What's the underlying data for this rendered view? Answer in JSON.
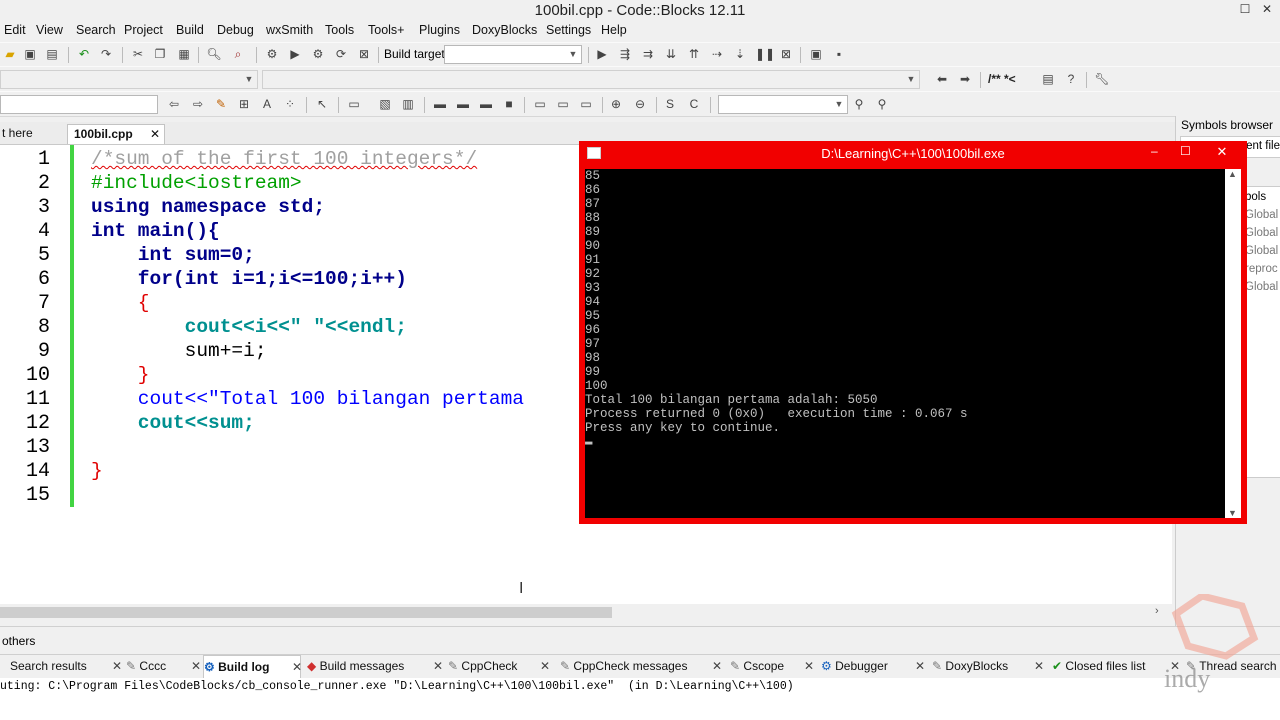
{
  "window": {
    "title": "100bil.cpp - Code::Blocks 12.11",
    "minimize": "–",
    "maximize": "☐",
    "close": "✕"
  },
  "menu": [
    "Edit",
    "View",
    "Search",
    "Project",
    "Build",
    "Debug",
    "wxSmith",
    "Tools",
    "Tools+",
    "Plugins",
    "DoxyBlocks",
    "Settings",
    "Help"
  ],
  "toolbar": {
    "build_target_label": "Build target:",
    "build_target_value": "",
    "doxy_comment": "/** *<"
  },
  "editor_tabs": [
    {
      "label": "t here",
      "active": false
    },
    {
      "label": "100bil.cpp",
      "active": true,
      "close": "✕"
    }
  ],
  "line_numbers": [
    "1",
    "2",
    "3",
    "4",
    "5",
    "6",
    "7",
    "8",
    "9",
    "10",
    "11",
    "12",
    "13",
    "14",
    "15"
  ],
  "code_lines": [
    "/*sum of the first 100 integers*/",
    "#include<iostream>",
    "using namespace std;",
    "int main(){",
    "    int sum=0;",
    "    for(int i=1;i<=100;i++)",
    "    {",
    "        cout<<i<<\" \"<<endl;",
    "        sum+=i;",
    "    }",
    "    cout<<\"Total 100 bilangan pertama",
    "    cout<<sum;",
    "",
    "}",
    ""
  ],
  "console": {
    "title": "D:\\Learning\\C++\\100\\100bil.exe",
    "output": "85\n86\n87\n88\n89\n90\n91\n92\n93\n94\n95\n96\n97\n98\n99\n100\nTotal 100 bilangan pertama adalah: 5050\nProcess returned 0 (0x0)   execution time : 0.067 s\nPress any key to continue.\n▬"
  },
  "right_panel": {
    "header": "Symbols browser",
    "tab_fragment": "ent file",
    "items": [
      "bols",
      "Global",
      "Global",
      "Global",
      "reproc",
      "Global"
    ]
  },
  "others_label": "others",
  "bottom_tabs": [
    {
      "label": "Search results",
      "icon": "search-icon"
    },
    {
      "label": "Cccc",
      "icon": "doc-icon"
    },
    {
      "label": "Build log",
      "icon": "gear-icon",
      "active": true
    },
    {
      "label": "Build messages",
      "icon": "diamond-icon"
    },
    {
      "label": "CppCheck",
      "icon": "doc-icon"
    },
    {
      "label": "CppCheck messages",
      "icon": "doc-icon"
    },
    {
      "label": "Cscope",
      "icon": "doc-icon"
    },
    {
      "label": "Debugger",
      "icon": "gear-icon"
    },
    {
      "label": "DoxyBlocks",
      "icon": "doc-icon"
    },
    {
      "label": "Closed files list",
      "icon": "check-icon"
    },
    {
      "label": "Thread search",
      "icon": "doc-icon"
    }
  ],
  "build_log_line": "uting: C:\\Program Files\\CodeBlocks/cb_console_runner.exe \"D:\\Learning\\C++\\100\\100bil.exe\"  (in D:\\Learning\\C++\\100)",
  "watermark_text": "indy",
  "colors": {
    "console_border": "#f10000",
    "console_bg": "#000000",
    "change_bar": "#42d442"
  }
}
